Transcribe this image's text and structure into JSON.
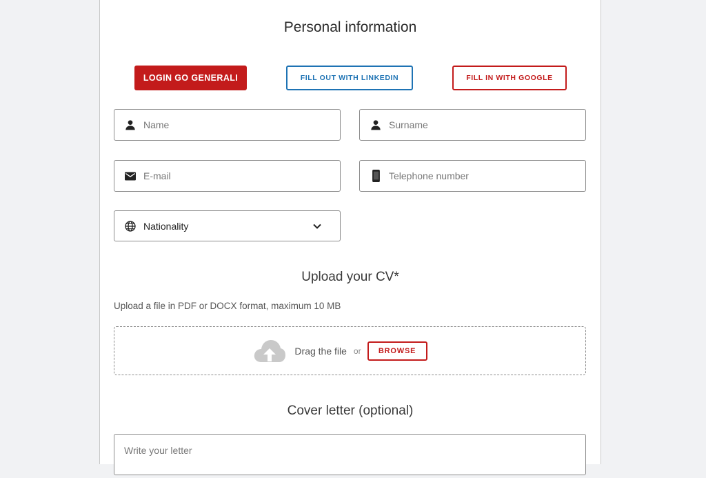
{
  "personal": {
    "title": "Personal information",
    "buttons": {
      "generali": "LOGIN GO GENERALI",
      "linkedin": "FILL OUT WITH LINKEDIN",
      "google": "FILL IN WITH GOOGLE"
    },
    "fields": {
      "name": {
        "placeholder": "Name",
        "icon": "person-icon"
      },
      "surname": {
        "placeholder": "Surname",
        "icon": "person-icon"
      },
      "email": {
        "placeholder": "E-mail",
        "icon": "mail-icon"
      },
      "phone": {
        "placeholder": "Telephone number",
        "icon": "phone-icon"
      },
      "nationality": {
        "value": "Nationality",
        "icon": "globe-icon"
      }
    }
  },
  "cv": {
    "title": "Upload your CV*",
    "hint": "Upload a file in PDF or DOCX format, maximum 10 MB",
    "drag_text": "Drag the file",
    "or_text": "or",
    "browse_label": "BROWSE",
    "icon": "cloud-upload-icon"
  },
  "cover": {
    "title": "Cover letter (optional)",
    "placeholder": "Write your letter"
  },
  "colors": {
    "brand_red": "#c31b1b",
    "linkedin_blue": "#1e73b4",
    "page_bg": "#f1f2f4"
  }
}
